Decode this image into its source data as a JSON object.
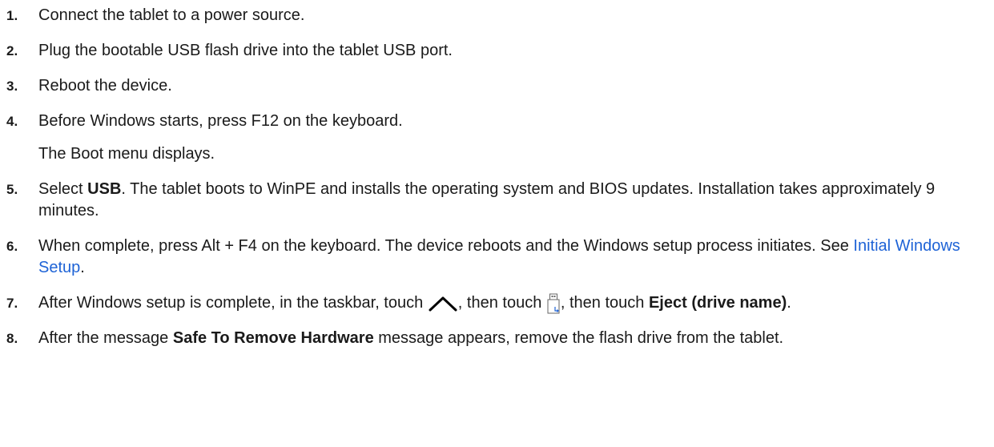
{
  "steps": [
    {
      "number": "1.",
      "text": "Connect the tablet to a power source."
    },
    {
      "number": "2.",
      "text": "Plug the bootable USB flash drive into the tablet USB port."
    },
    {
      "number": "3.",
      "text": "Reboot the device."
    },
    {
      "number": "4.",
      "text": "Before Windows starts, press F12 on the keyboard.",
      "note": "The Boot menu displays."
    },
    {
      "number": "5.",
      "pre": "Select ",
      "bold": "USB",
      "post": ". The tablet boots to WinPE and installs the operating system and BIOS updates. Installation takes approximately 9 minutes."
    },
    {
      "number": "6.",
      "pre": "When complete, press Alt + F4 on the keyboard. The device reboots and the Windows setup process initiates. See ",
      "link": "Initial Windows Setup",
      "post": "."
    },
    {
      "number": "7.",
      "pre": "After Windows setup is complete, in the taskbar, touch ",
      "icon1": "chevron-up-icon",
      "mid": ", then touch ",
      "icon2": "usb-drive-icon",
      "mid2": ", then touch ",
      "bold": "Eject (drive name)",
      "post": "."
    },
    {
      "number": "8.",
      "pre": "After the message ",
      "bold": "Safe To Remove Hardware",
      "post": " message appears, remove the flash drive from the tablet."
    }
  ],
  "colors": {
    "link": "#1e63d6",
    "text": "#1a1a1a"
  }
}
